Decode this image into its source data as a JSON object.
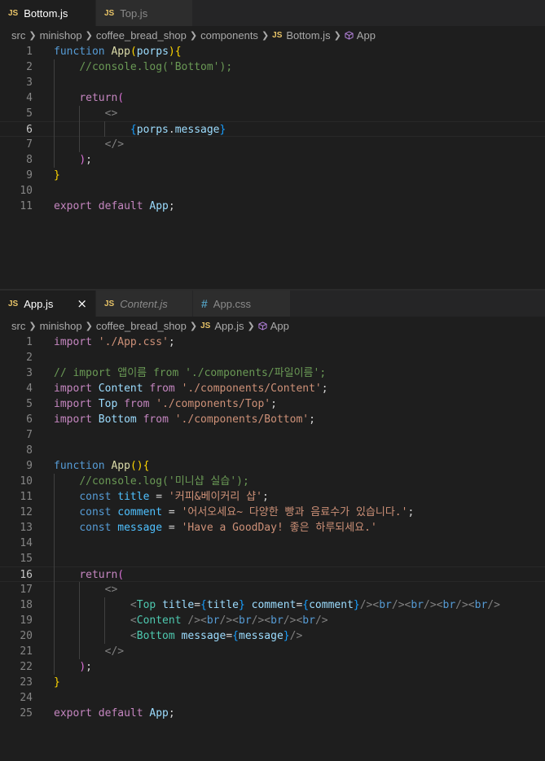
{
  "top_pane": {
    "tabs": [
      {
        "icon": "JS",
        "label": "Bottom.js",
        "active": true
      },
      {
        "icon": "JS",
        "label": "Top.js",
        "active": false
      }
    ],
    "breadcrumb": [
      "src",
      "minishop",
      "coffee_bread_shop",
      "components",
      "Bottom.js",
      "App"
    ],
    "lines": [
      [
        [
          "st",
          "function "
        ],
        [
          "fn",
          "App"
        ],
        [
          "b1",
          "("
        ],
        [
          "vr",
          "porps"
        ],
        [
          "b1",
          ")"
        ],
        [
          "b1",
          "{"
        ]
      ],
      [
        [
          "pl",
          "    "
        ],
        [
          "cm",
          "//console.log('Bottom');"
        ]
      ],
      [],
      [
        [
          "pl",
          "    "
        ],
        [
          "kw",
          "return"
        ],
        [
          "b2",
          "("
        ]
      ],
      [
        [
          "pl",
          "        "
        ],
        [
          "ang",
          "<>"
        ]
      ],
      [
        [
          "pl",
          "            "
        ],
        [
          "b3",
          "{"
        ],
        [
          "vr",
          "porps"
        ],
        [
          "pl",
          "."
        ],
        [
          "vr",
          "message"
        ],
        [
          "b3",
          "}"
        ]
      ],
      [
        [
          "pl",
          "        "
        ],
        [
          "ang",
          "</>"
        ]
      ],
      [
        [
          "pl",
          "    "
        ],
        [
          "b2",
          ")"
        ],
        [
          "pl",
          ";"
        ]
      ],
      [
        [
          "b1",
          "}"
        ]
      ],
      [],
      [
        [
          "kw",
          "export default "
        ],
        [
          "vr",
          "App"
        ],
        [
          "pl",
          ";"
        ]
      ]
    ],
    "current_line": 6
  },
  "bottom_pane": {
    "tabs": [
      {
        "icon": "JS",
        "label": "App.js",
        "active": true,
        "close": "×"
      },
      {
        "icon": "JS",
        "label": "Content.js",
        "active": false,
        "italic": true
      },
      {
        "icon": "#",
        "label": "App.css",
        "active": false
      }
    ],
    "breadcrumb": [
      "src",
      "minishop",
      "coffee_bread_shop",
      "App.js",
      "App"
    ],
    "lines": [
      [
        [
          "kw",
          "import "
        ],
        [
          "str",
          "'./App.css'"
        ],
        [
          "pl",
          ";"
        ]
      ],
      [],
      [
        [
          "cm",
          "// import 앱이름 from './components/파일이름';"
        ]
      ],
      [
        [
          "kw",
          "import "
        ],
        [
          "vr",
          "Content "
        ],
        [
          "kw",
          "from "
        ],
        [
          "str",
          "'./components/Content'"
        ],
        [
          "pl",
          ";"
        ]
      ],
      [
        [
          "kw",
          "import "
        ],
        [
          "vr",
          "Top "
        ],
        [
          "kw",
          "from "
        ],
        [
          "str",
          "'./components/Top'"
        ],
        [
          "pl",
          ";"
        ]
      ],
      [
        [
          "kw",
          "import "
        ],
        [
          "vr",
          "Bottom "
        ],
        [
          "kw",
          "from "
        ],
        [
          "str",
          "'./components/Bottom'"
        ],
        [
          "pl",
          ";"
        ]
      ],
      [],
      [],
      [
        [
          "st",
          "function "
        ],
        [
          "fn",
          "App"
        ],
        [
          "b1",
          "()"
        ],
        [
          "b1",
          "{"
        ]
      ],
      [
        [
          "pl",
          "    "
        ],
        [
          "cm",
          "//console.log('미니샵 실습');"
        ]
      ],
      [
        [
          "pl",
          "    "
        ],
        [
          "st",
          "const "
        ],
        [
          "cn",
          "title"
        ],
        [
          "pl",
          " = "
        ],
        [
          "str",
          "'커피&베이커리 샵'"
        ],
        [
          "pl",
          ";"
        ]
      ],
      [
        [
          "pl",
          "    "
        ],
        [
          "st",
          "const "
        ],
        [
          "cn",
          "comment"
        ],
        [
          "pl",
          " = "
        ],
        [
          "str",
          "'어서오세요~ 다양한 빵과 음료수가 있습니다.'"
        ],
        [
          "pl",
          ";"
        ]
      ],
      [
        [
          "pl",
          "    "
        ],
        [
          "st",
          "const "
        ],
        [
          "cn",
          "message"
        ],
        [
          "pl",
          " = "
        ],
        [
          "str",
          "'Have a GoodDay! 좋은 하루되세요.'"
        ]
      ],
      [],
      [],
      [
        [
          "pl",
          "    "
        ],
        [
          "kw",
          "return"
        ],
        [
          "b2",
          "("
        ]
      ],
      [
        [
          "pl",
          "        "
        ],
        [
          "ang",
          "<>"
        ]
      ],
      [
        [
          "pl",
          "            "
        ],
        [
          "ang",
          "<"
        ],
        [
          "tg",
          "Top "
        ],
        [
          "vr",
          "title"
        ],
        [
          "pl",
          "="
        ],
        [
          "b3",
          "{"
        ],
        [
          "vr",
          "title"
        ],
        [
          "b3",
          "}"
        ],
        [
          "pl",
          " "
        ],
        [
          "vr",
          "comment"
        ],
        [
          "pl",
          "="
        ],
        [
          "b3",
          "{"
        ],
        [
          "vr",
          "comment"
        ],
        [
          "b3",
          "}"
        ],
        [
          "ang",
          "/><"
        ],
        [
          "st",
          "br"
        ],
        [
          "ang",
          "/><"
        ],
        [
          "st",
          "br"
        ],
        [
          "ang",
          "/><"
        ],
        [
          "st",
          "br"
        ],
        [
          "ang",
          "/><"
        ],
        [
          "st",
          "br"
        ],
        [
          "ang",
          "/>"
        ]
      ],
      [
        [
          "pl",
          "            "
        ],
        [
          "ang",
          "<"
        ],
        [
          "tg",
          "Content "
        ],
        [
          "ang",
          "/><"
        ],
        [
          "st",
          "br"
        ],
        [
          "ang",
          "/><"
        ],
        [
          "st",
          "br"
        ],
        [
          "ang",
          "/><"
        ],
        [
          "st",
          "br"
        ],
        [
          "ang",
          "/><"
        ],
        [
          "st",
          "br"
        ],
        [
          "ang",
          "/>"
        ]
      ],
      [
        [
          "pl",
          "            "
        ],
        [
          "ang",
          "<"
        ],
        [
          "tg",
          "Bottom "
        ],
        [
          "vr",
          "message"
        ],
        [
          "pl",
          "="
        ],
        [
          "b3",
          "{"
        ],
        [
          "vr",
          "message"
        ],
        [
          "b3",
          "}"
        ],
        [
          "ang",
          "/>"
        ]
      ],
      [
        [
          "pl",
          "        "
        ],
        [
          "ang",
          "</>"
        ]
      ],
      [
        [
          "pl",
          "    "
        ],
        [
          "b2",
          ")"
        ],
        [
          "pl",
          ";"
        ]
      ],
      [
        [
          "b1",
          "}"
        ]
      ],
      [],
      [
        [
          "kw",
          "export default "
        ],
        [
          "vr",
          "App"
        ],
        [
          "pl",
          ";"
        ]
      ]
    ],
    "current_line": 16
  },
  "colors": {
    "background": "#1e1e1e",
    "tab_inactive": "#2d2d2d",
    "keyword_purple": "#c586c0",
    "storage_blue": "#569cd6",
    "string_orange": "#ce9178",
    "comment_green": "#6a9955",
    "component_teal": "#4ec9b0",
    "js_icon_yellow": "#e8c468"
  }
}
